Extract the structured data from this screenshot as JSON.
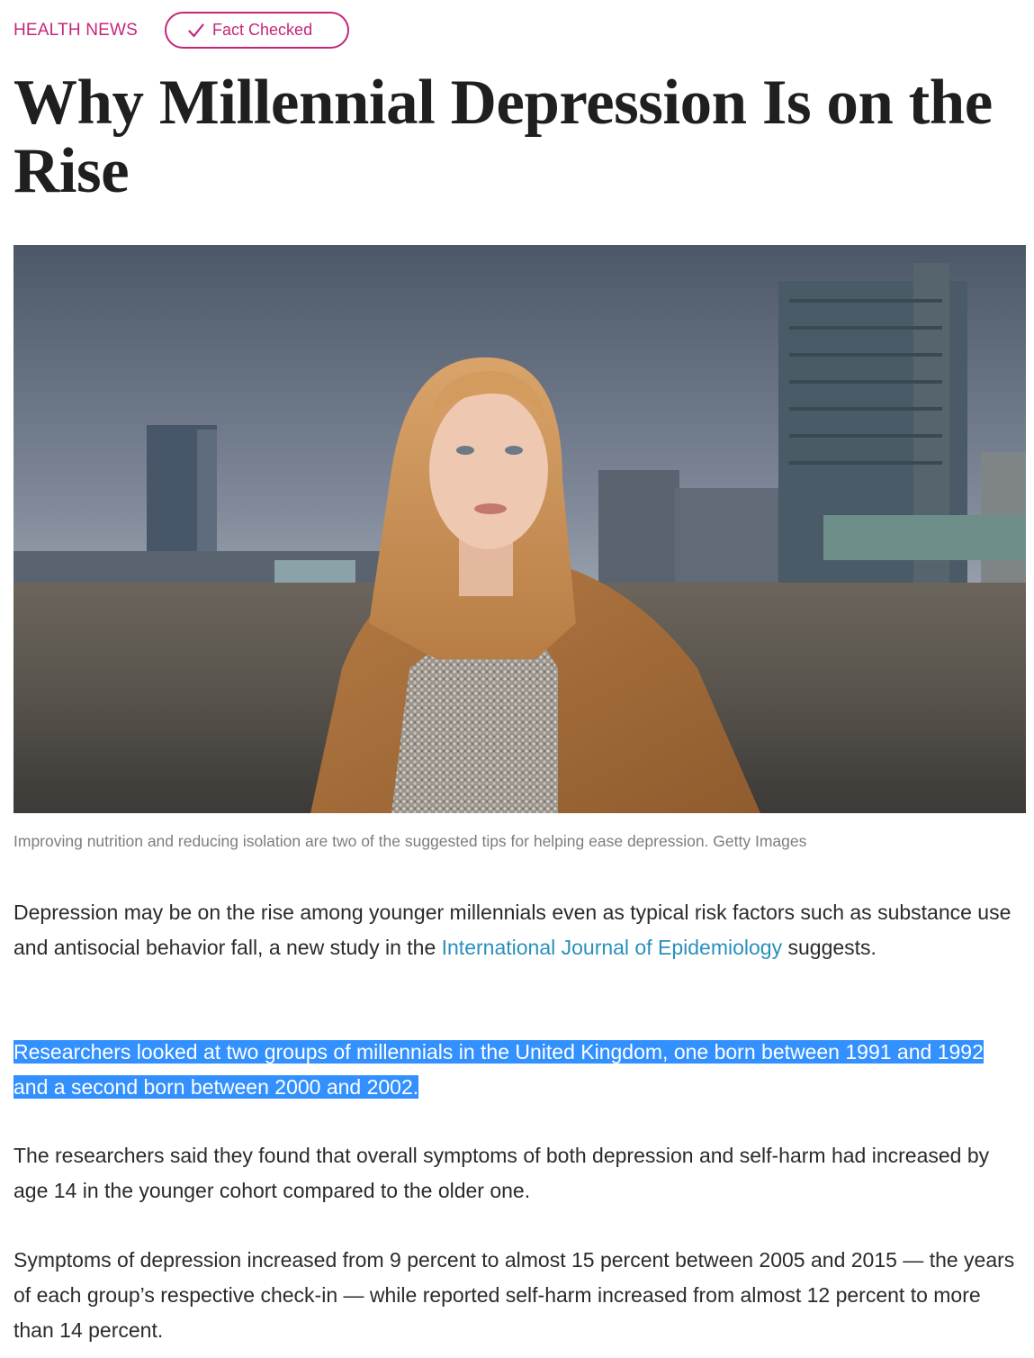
{
  "header": {
    "category": "HEALTH NEWS",
    "fact_checked": "Fact Checked",
    "check_icon": "checkmark-icon",
    "accent_color": "#c5267a"
  },
  "article": {
    "title": "Why Millennial Depression Is on the Rise",
    "image_caption": "Improving nutrition and reducing isolation are two of the suggested tips for helping ease depression. Getty Images",
    "paragraph1": {
      "before": "Depression may be on the rise among younger millennials even as typical risk factors such as substance use and antisocial behavior fall, a new study in the ",
      "link": "International Journal of Epidemiology",
      "after": " suggests."
    },
    "paragraph2": "Researchers looked at two groups of millennials in the United Kingdom, one born between 1991 and 1992 and a second born between 2000 and 2002.",
    "paragraph3": "The researchers said they found that overall symptoms of both depression and self-harm had increased by age 14 in the younger cohort compared to the older one.",
    "paragraph4": "Symptoms of depression increased from 9 percent to almost 15 percent between 2005 and 2015 — the years of each group’s respective check-in — while reported self-harm increased from almost 12 percent to more than 14 percent."
  },
  "colors": {
    "link": "#2a8fbd",
    "selection": "#3390ff"
  }
}
